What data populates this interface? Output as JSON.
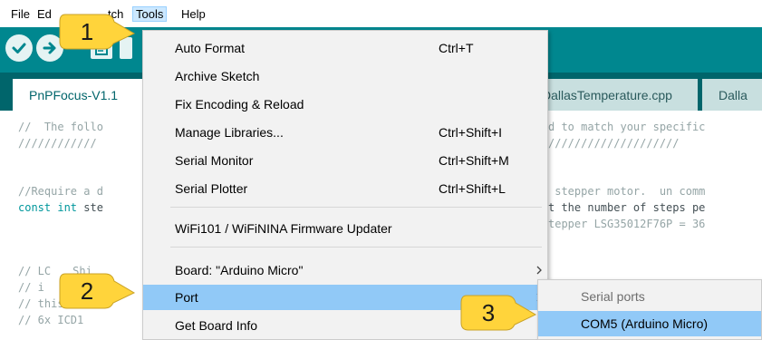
{
  "menubar": {
    "items": [
      {
        "label": "File"
      },
      {
        "label": "Ed"
      },
      {
        "label": "tch"
      },
      {
        "label": "Tools"
      },
      {
        "label": "Help"
      }
    ]
  },
  "tabs": [
    {
      "label": "PnPFocus-V1.1"
    },
    {
      "label": "DallasTemperature.cpp"
    },
    {
      "label": "Dalla"
    }
  ],
  "code": {
    "lines": [
      {
        "pre": "//  The follo",
        "post": "d to match your specific"
      },
      {
        "pre": "////////////",
        "post": "////////////////////"
      },
      {
        "pre": "",
        "post": ""
      },
      {
        "pre": "//Require a d",
        "post": " stepper motor.  un comm"
      },
      {
        "kw": "const int",
        "pre": " ste",
        "post": "t the number of steps pe"
      },
      {
        "pre": "",
        "post": "tepper LSG35012F76P = 36"
      },
      {
        "pre": "",
        "post": ""
      },
      {
        "pre": "// LC",
        "mid": "Shi",
        "post": ""
      },
      {
        "pre": "// i",
        "post": ""
      },
      {
        "pre": "// this is li",
        "post": ""
      },
      {
        "pre": "// 6x ICD1",
        "post": ""
      }
    ]
  },
  "tools_menu": {
    "items": [
      {
        "label": "Auto Format",
        "shortcut": "Ctrl+T"
      },
      {
        "label": "Archive Sketch",
        "shortcut": ""
      },
      {
        "label": "Fix Encoding & Reload",
        "shortcut": ""
      },
      {
        "label": "Manage Libraries...",
        "shortcut": "Ctrl+Shift+I"
      },
      {
        "label": "Serial Monitor",
        "shortcut": "Ctrl+Shift+M"
      },
      {
        "label": "Serial Plotter",
        "shortcut": "Ctrl+Shift+L"
      },
      {
        "label": "WiFi101 / WiFiNINA Firmware Updater",
        "shortcut": ""
      },
      {
        "label": "Board: \"Arduino Micro\"",
        "shortcut": ""
      },
      {
        "label": "Port",
        "shortcut": ""
      },
      {
        "label": "Get Board Info",
        "shortcut": ""
      }
    ]
  },
  "port_submenu": {
    "header": "Serial ports",
    "selected": "COM5 (Arduino Micro)"
  },
  "callouts": [
    {
      "number": "1"
    },
    {
      "number": "2"
    },
    {
      "number": "3"
    }
  ],
  "colors": {
    "toolbar": "#00878f",
    "tabstrip": "#00656b",
    "menu_highlight": "#91c9f7",
    "callout_fill": "#ffd43b"
  }
}
